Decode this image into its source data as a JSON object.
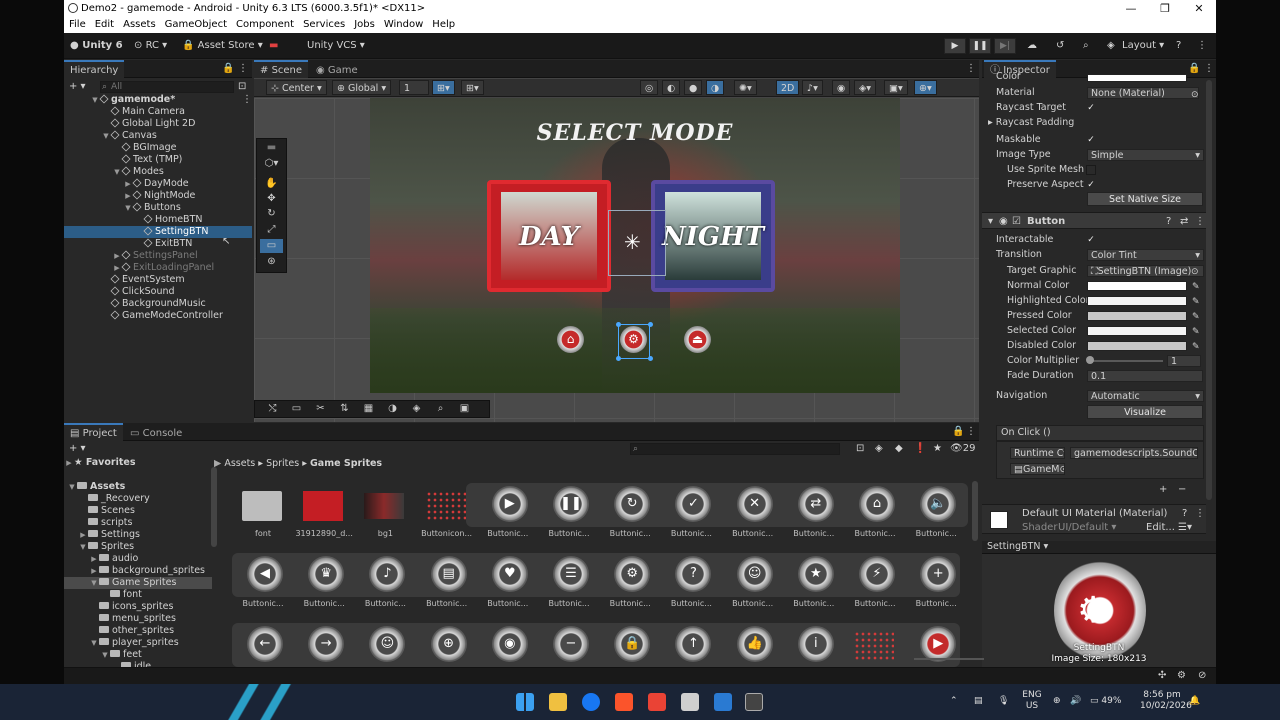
{
  "window": {
    "title": "Demo2 - gamemode - Android - Unity 6.3 LTS (6000.3.5f1)* <DX11>",
    "controls": [
      "—",
      "❐",
      "✕"
    ]
  },
  "menu": [
    "File",
    "Edit",
    "Assets",
    "GameObject",
    "Component",
    "Services",
    "Jobs",
    "Window",
    "Help"
  ],
  "toolbar": {
    "unity": "Unity 6",
    "rc": "RC",
    "asset_store": "Asset Store",
    "vcs": "Unity VCS",
    "layout": "Layout"
  },
  "hierarchy": {
    "tab": "Hierarchy",
    "search_placeholder": "All",
    "rows": [
      {
        "label": "gamemode*",
        "depth": 0,
        "arrow": "▼",
        "state": "scene"
      },
      {
        "label": "Main Camera",
        "depth": 1,
        "arrow": "",
        "state": ""
      },
      {
        "label": "Global Light 2D",
        "depth": 1,
        "arrow": "",
        "state": ""
      },
      {
        "label": "Canvas",
        "depth": 1,
        "arrow": "▼",
        "state": ""
      },
      {
        "label": "BGImage",
        "depth": 2,
        "arrow": "",
        "state": ""
      },
      {
        "label": "Text (TMP)",
        "depth": 2,
        "arrow": "",
        "state": ""
      },
      {
        "label": "Modes",
        "depth": 2,
        "arrow": "▼",
        "state": ""
      },
      {
        "label": "DayMode",
        "depth": 3,
        "arrow": "▶",
        "state": ""
      },
      {
        "label": "NightMode",
        "depth": 3,
        "arrow": "▶",
        "state": ""
      },
      {
        "label": "Buttons",
        "depth": 3,
        "arrow": "▼",
        "state": ""
      },
      {
        "label": "HomeBTN",
        "depth": 4,
        "arrow": "",
        "state": ""
      },
      {
        "label": "SettingBTN",
        "depth": 4,
        "arrow": "",
        "state": "selected"
      },
      {
        "label": "ExitBTN",
        "depth": 4,
        "arrow": "",
        "state": ""
      },
      {
        "label": "SettingsPanel",
        "depth": 2,
        "arrow": "▶",
        "state": "dim"
      },
      {
        "label": "ExitLoadingPanel",
        "depth": 2,
        "arrow": "▶",
        "state": "dim"
      },
      {
        "label": "EventSystem",
        "depth": 1,
        "arrow": "",
        "state": ""
      },
      {
        "label": "ClickSound",
        "depth": 1,
        "arrow": "",
        "state": ""
      },
      {
        "label": "BackgroundMusic",
        "depth": 1,
        "arrow": "",
        "state": ""
      },
      {
        "label": "GameModeController",
        "depth": 1,
        "arrow": "",
        "state": ""
      }
    ]
  },
  "scene": {
    "tabs": [
      "Scene",
      "Game"
    ],
    "pivot": "Center",
    "space": "Global",
    "grid": "1",
    "mode2d": "2D",
    "game_title": "SELECT MODE",
    "day_label": "DAY",
    "night_label": "NIGHT"
  },
  "inspector": {
    "tab": "Inspector",
    "color_label": "Color",
    "material_label": "Material",
    "material_value": "None (Material)",
    "raycast_target": "Raycast Target",
    "raycast_padding": "Raycast Padding",
    "maskable": "Maskable",
    "image_type": "Image Type",
    "image_type_value": "Simple",
    "use_sprite_mesh": "Use Sprite Mesh",
    "preserve_aspect": "Preserve Aspect",
    "set_native_size": "Set Native Size",
    "button_component": "Button",
    "interactable": "Interactable",
    "transition": "Transition",
    "transition_value": "Color Tint",
    "target_graphic": "Target Graphic",
    "target_graphic_value": "SettingBTN (Image)",
    "normal_color": "Normal Color",
    "highlighted_color": "Highlighted Color",
    "pressed_color": "Pressed Color",
    "selected_color": "Selected Color",
    "disabled_color": "Disabled Color",
    "color_multiplier": "Color Multiplier",
    "color_multiplier_value": "1",
    "fade_duration": "Fade Duration",
    "fade_duration_value": "0.1",
    "navigation": "Navigation",
    "navigation_value": "Automatic",
    "visualize": "Visualize",
    "on_click": "On Click ()",
    "runtime": "Runtime C▾",
    "function": "gamemodescripts.SoundC▾",
    "object": "GameM",
    "material_component": "Default UI Material (Material)",
    "shader_label": "Shader",
    "shader_value": "UI/Default",
    "edit": "Edit...",
    "footer": "SettingBTN ▾",
    "preview_name": "SettingBTN",
    "preview_size": "Image Size: 180x213"
  },
  "project": {
    "tabs": [
      "Project",
      "Console"
    ],
    "favorites": "Favorites",
    "breadcrumb": [
      "Assets",
      "Sprites",
      "Game Sprites"
    ],
    "item_count": "29",
    "folders": [
      {
        "label": "Assets",
        "depth": 0,
        "arrow": "▼",
        "bold": true
      },
      {
        "label": "_Recovery",
        "depth": 1,
        "arrow": ""
      },
      {
        "label": "Scenes",
        "depth": 1,
        "arrow": ""
      },
      {
        "label": "scripts",
        "depth": 1,
        "arrow": ""
      },
      {
        "label": "Settings",
        "depth": 1,
        "arrow": "▶"
      },
      {
        "label": "Sprites",
        "depth": 1,
        "arrow": "▼"
      },
      {
        "label": "audio",
        "depth": 2,
        "arrow": "▶"
      },
      {
        "label": "background_sprites",
        "depth": 2,
        "arrow": "▶"
      },
      {
        "label": "Game Sprites",
        "depth": 2,
        "arrow": "▼",
        "selected": true
      },
      {
        "label": "font",
        "depth": 3,
        "arrow": ""
      },
      {
        "label": "icons_sprites",
        "depth": 2,
        "arrow": ""
      },
      {
        "label": "menu_sprites",
        "depth": 2,
        "arrow": ""
      },
      {
        "label": "other_sprites",
        "depth": 2,
        "arrow": ""
      },
      {
        "label": "player_sprites",
        "depth": 2,
        "arrow": "▼"
      },
      {
        "label": "feet",
        "depth": 3,
        "arrow": "▼"
      },
      {
        "label": "idle",
        "depth": 4,
        "arrow": ""
      }
    ],
    "assets_row1": [
      "font",
      "31912890_d...",
      "bg1",
      "Buttonicon...",
      "Buttonic...",
      "Buttonic...",
      "Buttonic...",
      "Buttonic...",
      "Buttonic...",
      "Buttonic...",
      "Buttonic...",
      "Buttonic..."
    ],
    "row1_glyphs": [
      "",
      "",
      "",
      "",
      "▶",
      "❚❚",
      "↻",
      "✓",
      "✕",
      "⇄",
      "⌂",
      "🔈"
    ],
    "assets_row2": [
      "Buttonic...",
      "Buttonic...",
      "Buttonic...",
      "Buttonic...",
      "Buttonic...",
      "Buttonic...",
      "Buttonic...",
      "Buttonic...",
      "Buttonic...",
      "Buttonic...",
      "Buttonic...",
      "Buttonic..."
    ],
    "row2_glyphs": [
      "◀",
      "♛",
      "♪",
      "▤",
      "♥",
      "☰",
      "⚙",
      "?",
      "☺",
      "★",
      "⚡",
      "+"
    ],
    "row3_glyphs": [
      "←",
      "→",
      "☺",
      "⊕",
      "◉",
      "−",
      "🔒",
      "↑",
      "👍",
      "i",
      "",
      "▶"
    ]
  },
  "taskbar": {
    "lang": "ENG",
    "region": "US",
    "battery": "49%",
    "time": "8:56 pm",
    "date": "10/02/2026"
  },
  "colors": {
    "accent": "#3a79bb",
    "selection": "#2c5d87",
    "panel": "#282828"
  }
}
